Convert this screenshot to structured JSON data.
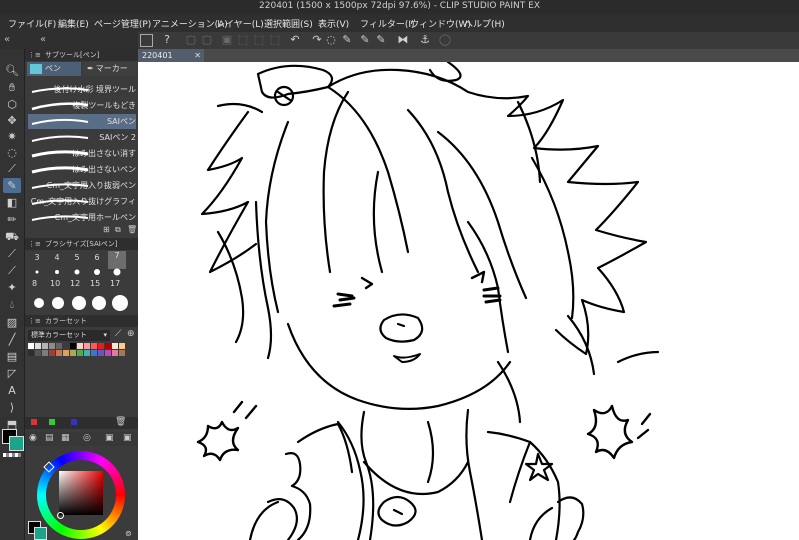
{
  "window": {
    "title": "220401 (1500 x 1500px 72dpi 97.6%) - CLIP STUDIO PAINT EX"
  },
  "menu": [
    "ファイル(F)",
    "編集(E)",
    "ページ管理(P)",
    "アニメーション(A)",
    "レイヤー(L)",
    "選択範囲(S)",
    "表示(V)",
    "フィルター(I)",
    "ウィンドウ(W)",
    "ヘルプ(H)"
  ],
  "panels": {
    "sub_tool": {
      "header": "サブツール[ペン]",
      "group_tabs": [
        "ペン",
        "マーカー"
      ],
      "brushes": [
        "後付け水彩 境界ツール",
        "複製ツールもどき",
        "SAIペン",
        "SAIペン 2",
        "はみ出さない消す",
        "はみ出さないペン",
        "Cm_文字用入り抜弱ペン",
        "Cm_文字用入り抜けグラフィ",
        "Cm_文字用ホールペン"
      ],
      "selected_index": 2
    },
    "brush_size": {
      "header": "ブラシサイズ[SAIペン]",
      "sizes": [
        "3",
        "4",
        "5",
        "6",
        "7",
        "8",
        "10",
        "12",
        "15",
        "17"
      ],
      "selected": "7"
    },
    "color_set": {
      "header": "カラーセット",
      "set_name": "標準カラーセット"
    }
  },
  "document": {
    "tab_label": "220401"
  },
  "colors": {
    "accent": "#4d6d93",
    "main_color": "#000000",
    "sub_color": "#1aa58a",
    "swatches": [
      "#ffffff",
      "#dcdcdc",
      "#b4b4b4",
      "#8c8c8c",
      "#646464",
      "#3c3c3c",
      "#000000",
      "#ffd2d2",
      "#ff9b9b",
      "#ff5a5a",
      "#e61e1e",
      "#b40000",
      "#ffe6c8",
      "#ffc88c",
      "#2d2d2d",
      "#555",
      "#7d7d7d",
      "#a53c3c",
      "#c87850",
      "#dca064",
      "#aaaa50",
      "#50aa50",
      "#3cb4b4",
      "#3c78c8",
      "#6e50c8",
      "#b450b4",
      "#e678a0",
      "#a0785a"
    ]
  }
}
